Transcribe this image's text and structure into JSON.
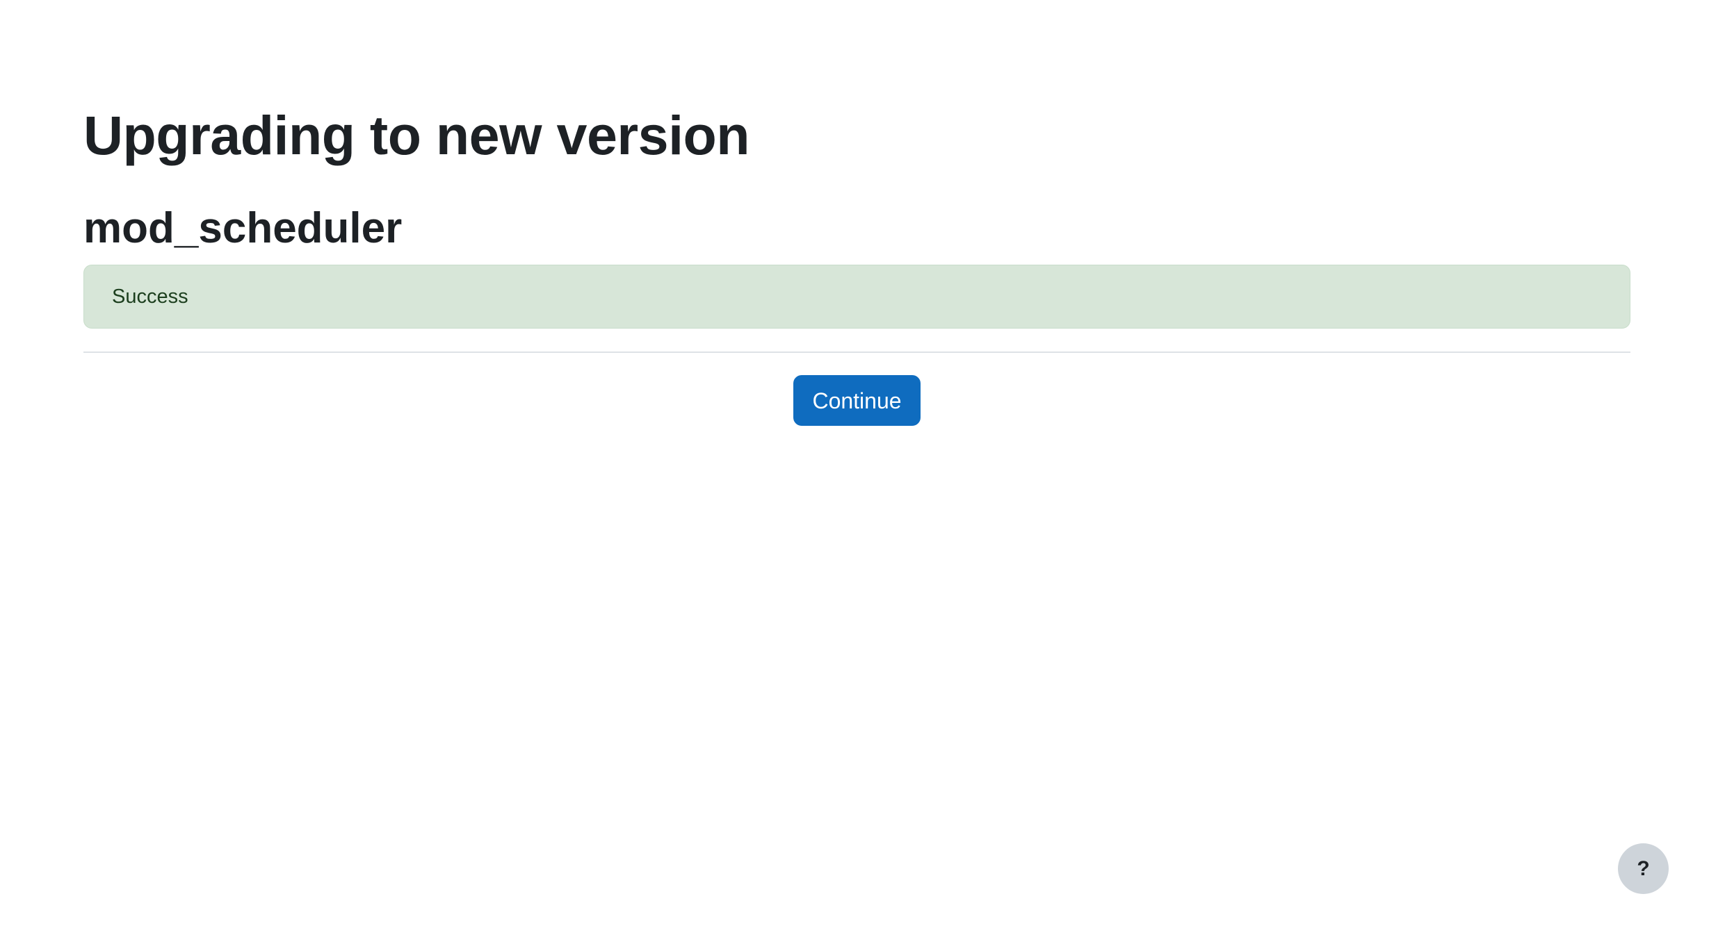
{
  "page": {
    "title": "Upgrading to new version",
    "plugin_name": "mod_scheduler"
  },
  "alert": {
    "type": "success",
    "message": "Success",
    "color": "#d7e6d8"
  },
  "actions": {
    "continue_label": "Continue",
    "accent_color": "#0f6cbf"
  },
  "help": {
    "icon": "question-icon",
    "glyph": "?"
  }
}
